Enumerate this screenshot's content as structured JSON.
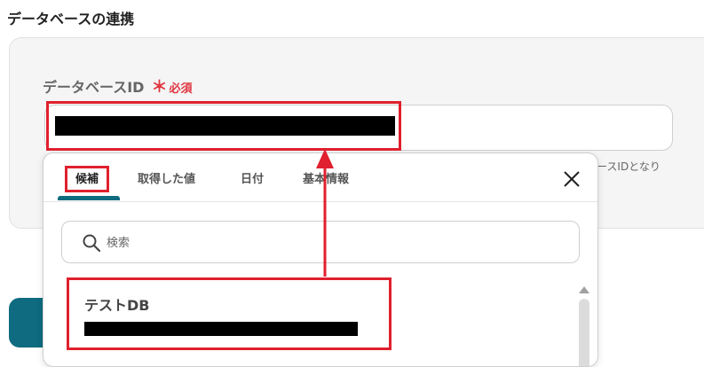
{
  "section": {
    "title": "データベースの連携"
  },
  "field": {
    "label": "データベースID",
    "required_mark": "＊",
    "required_text": "必須",
    "help_text_partial": "ースIDとなり"
  },
  "popover": {
    "tabs": [
      {
        "label": "候補",
        "active": true
      },
      {
        "label": "取得した値",
        "active": false
      },
      {
        "label": "日付",
        "active": false
      },
      {
        "label": "基本情報",
        "active": false
      }
    ],
    "search": {
      "placeholder": "検索",
      "value": ""
    },
    "options": [
      {
        "title": "テストDB"
      }
    ]
  },
  "colors": {
    "accent": "#0f6b80",
    "highlight": "#e0202e",
    "required": "#e0353f"
  },
  "icons": [
    "close-icon",
    "search-icon",
    "scroll-up-arrow-icon",
    "arrow-up-icon"
  ]
}
